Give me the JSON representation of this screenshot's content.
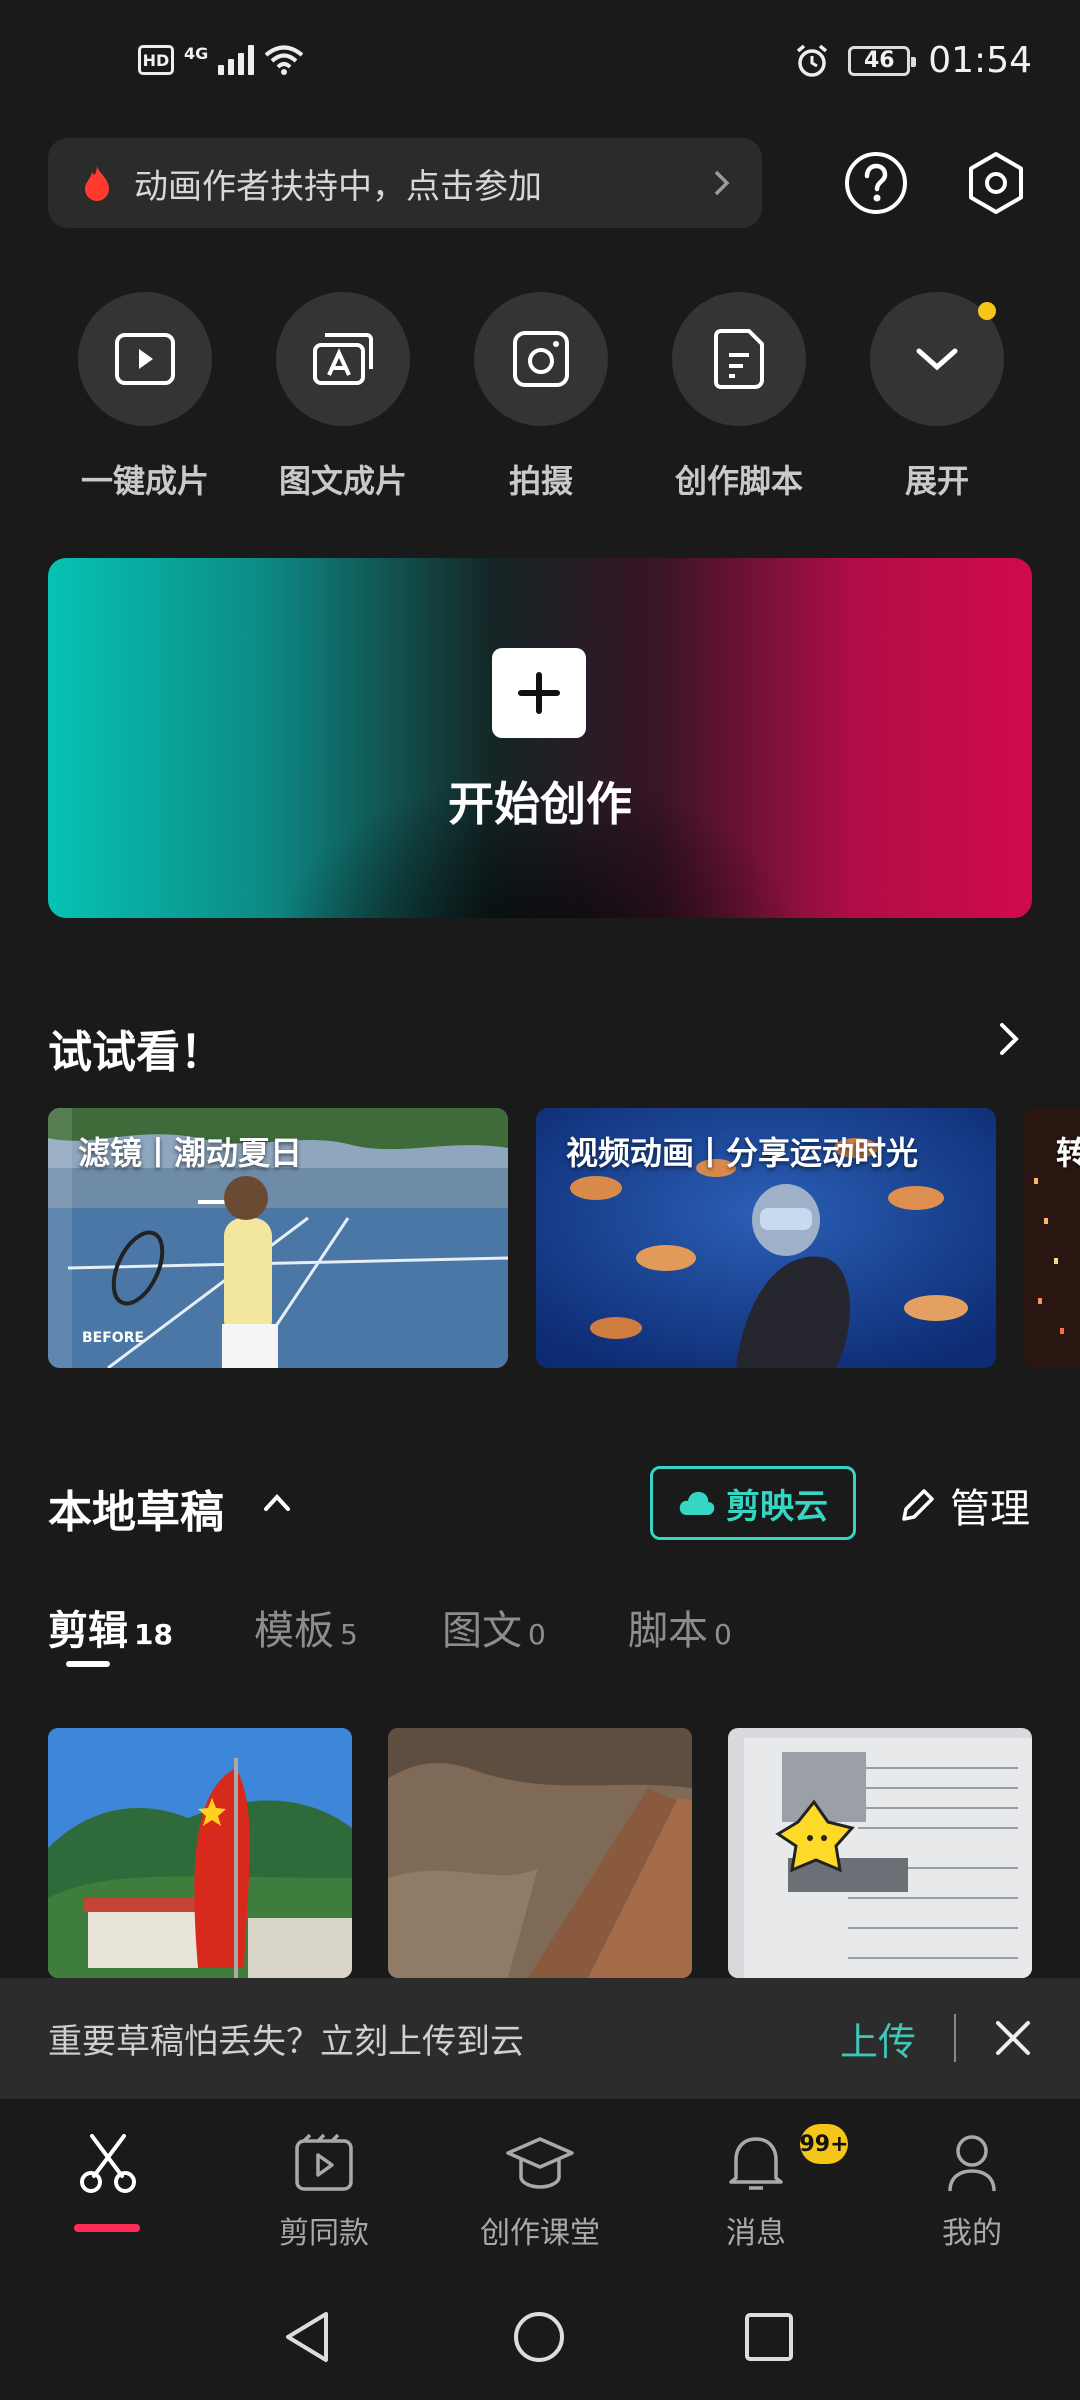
{
  "status_bar": {
    "hd": "HD",
    "network": "4G",
    "battery": "46",
    "time": "01:54"
  },
  "promo": {
    "text": "动画作者扶持中，点击参加"
  },
  "quick_actions": [
    {
      "label": "一键成片",
      "icon": "play-icon"
    },
    {
      "label": "图文成片",
      "icon": "image-text-icon"
    },
    {
      "label": "拍摄",
      "icon": "camera-icon"
    },
    {
      "label": "创作脚本",
      "icon": "script-icon"
    },
    {
      "label": "展开",
      "icon": "chevron-down-icon"
    }
  ],
  "create": {
    "title": "开始创作"
  },
  "try_section": {
    "title": "试试看！",
    "cards": [
      {
        "caption": "滤镜丨潮动夏日",
        "tag": "BEFORE"
      },
      {
        "caption": "视频动画丨分享运动时光"
      },
      {
        "caption": "转"
      }
    ]
  },
  "drafts": {
    "title": "本地草稿",
    "cloud_label": "剪映云",
    "manage_label": "管理",
    "tabs": [
      {
        "label": "剪辑",
        "count": "18"
      },
      {
        "label": "模板",
        "count": "5"
      },
      {
        "label": "图文",
        "count": "0"
      },
      {
        "label": "脚本",
        "count": "0"
      }
    ]
  },
  "toast": {
    "message": "重要草稿怕丢失？立刻上传到云",
    "upload": "上传"
  },
  "bottom_nav": {
    "items": [
      {
        "label": ""
      },
      {
        "label": "剪同款"
      },
      {
        "label": "创作课堂"
      },
      {
        "label": "消息"
      },
      {
        "label": "我的"
      }
    ],
    "badge": "99+"
  },
  "colors": {
    "accent": "#35d6c4",
    "active": "#ff2d55",
    "badge": "#f5c518"
  }
}
